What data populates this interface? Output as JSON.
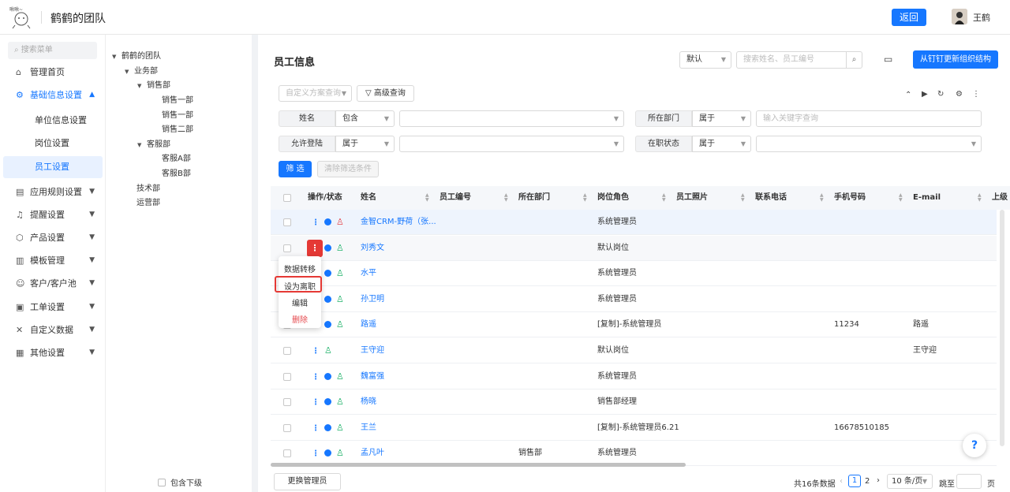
{
  "header": {
    "team": "鹤鹤的团队",
    "back": "返回",
    "user": "王鹤"
  },
  "sidebar": {
    "search_placeholder": "搜索菜单",
    "items": [
      {
        "label": "管理首页",
        "icon": "home-icon"
      },
      {
        "label": "基础信息设置",
        "icon": "settings-icon",
        "active": true
      },
      {
        "label": "应用规则设置",
        "icon": "document-icon"
      },
      {
        "label": "提醒设置",
        "icon": "bell-icon"
      },
      {
        "label": "产品设置",
        "icon": "box-icon"
      },
      {
        "label": "模板管理",
        "icon": "template-icon"
      },
      {
        "label": "客户/客户池",
        "icon": "customer-icon"
      },
      {
        "label": "工单设置",
        "icon": "ticket-icon"
      },
      {
        "label": "自定义数据",
        "icon": "tools-icon"
      },
      {
        "label": "其他设置",
        "icon": "grid-icon"
      }
    ],
    "subitems": [
      "单位信息设置",
      "岗位设置",
      "员工设置"
    ]
  },
  "tree": {
    "root": "鹤鹤的团队",
    "n1": "业务部",
    "n2": "销售部",
    "n3": "销售一部",
    "n4": "销售一部",
    "n5": "销售二部",
    "n6": "客服部",
    "n7": "客服A部",
    "n8": "客服B部",
    "n9": "技术部",
    "n10": "运营部",
    "include_sub": "包含下级"
  },
  "main": {
    "title": "员工信息",
    "default_select": "默认",
    "search_placeholder": "搜索姓名、员工编号",
    "sync_btn": "从钉钉更新组织结构",
    "custom_query_placeholder": "自定义方案查询",
    "adv_query": "高级查询",
    "filters": {
      "name_label": "姓名",
      "name_op": "包含",
      "dept_label": "所在部门",
      "dept_op": "属于",
      "dept_placeholder": "输入关键字查询",
      "login_label": "允许登陆",
      "login_op": "属于",
      "status_label": "在职状态",
      "status_op": "属于"
    },
    "filter_btn": "筛 选",
    "clear_btn": "清除筛选条件",
    "columns": [
      "操作/状态",
      "姓名",
      "员工编号",
      "所在部门",
      "岗位角色",
      "员工照片",
      "联系电话",
      "手机号码",
      "E-mail",
      "上级"
    ],
    "rows": [
      {
        "name": "金智CRM-野荷（张...",
        "dept": "",
        "role": "系统管理员",
        "mobile": "",
        "email": "",
        "status": "red"
      },
      {
        "name": "刘秀文",
        "dept": "",
        "role": "默认岗位",
        "mobile": "",
        "email": "",
        "status": "grn"
      },
      {
        "name": "水平",
        "dept": "",
        "role": "系统管理员",
        "mobile": "",
        "email": "",
        "status": "grn"
      },
      {
        "name": "孙卫明",
        "dept": "",
        "role": "系统管理员",
        "mobile": "",
        "email": "",
        "status": "grn"
      },
      {
        "name": "路遥",
        "dept": "",
        "role": "[复制]-系统管理员",
        "mobile": "11234",
        "email": "路遥",
        "status": "grn"
      },
      {
        "name": "王守迎",
        "dept": "",
        "role": "默认岗位",
        "mobile": "",
        "email": "王守迎",
        "status": "grn"
      },
      {
        "name": "魏富强",
        "dept": "",
        "role": "系统管理员",
        "mobile": "",
        "email": "",
        "status": "grn"
      },
      {
        "name": "杨晓",
        "dept": "",
        "role": "销售部经理",
        "mobile": "",
        "email": "",
        "status": "grn"
      },
      {
        "name": "王兰",
        "dept": "",
        "role": "[复制]-系统管理员6.21",
        "mobile": "16678510185",
        "email": "",
        "status": "grn"
      },
      {
        "name": "孟凡叶",
        "dept": "销售部",
        "role": "系统管理员",
        "mobile": "",
        "email": "",
        "status": "grn"
      }
    ],
    "popup": [
      "数据转移",
      "设为离职",
      "编辑",
      "删除"
    ],
    "change_admin": "更换管理员",
    "total": "共16条数据",
    "page1": "1",
    "page2": "2",
    "page_size": "10 条/页",
    "jump": "跳至",
    "page_unit": "页",
    "help": "?"
  }
}
